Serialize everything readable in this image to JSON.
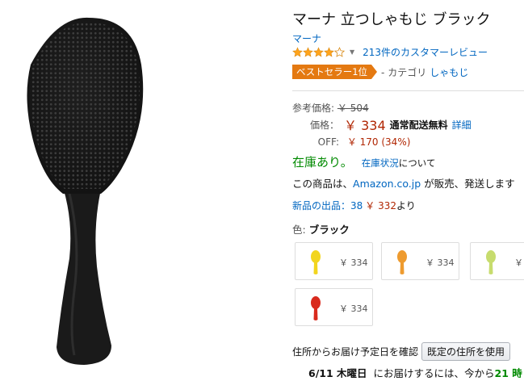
{
  "product": {
    "title": "マーナ 立つしゃもじ ブラック",
    "brand": "マーナ",
    "rating_value": 4,
    "review_link": "213件のカスタマーレビュー",
    "bestseller_badge": "ベストセラー1位",
    "category_sep": "- カテゴリ",
    "category_link": "しゃもじ"
  },
  "pricing": {
    "ref_label": "参考価格:",
    "ref_price": "￥ 504",
    "price_label": "価格：",
    "price": "￥ 334",
    "shipping": "通常配送無料",
    "details_link": "詳細",
    "off_label": "OFF:",
    "off_value": "￥ 170 (34%)"
  },
  "availability": {
    "in_stock": "在庫あり。",
    "stock_status_link": "在庫状況",
    "stock_status_suffix": "について",
    "sold_by_prefix": "この商品は、",
    "sold_by_link": "Amazon.co.jp",
    "sold_by_suffix": " が販売、発送します"
  },
  "offers": {
    "link": "新品の出品：38",
    "price": "￥ 332",
    "suffix": "より"
  },
  "color": {
    "label": "色:",
    "selected": "ブラック",
    "swatches": [
      {
        "name": "yellow",
        "price": "￥ 334",
        "color": "#f2d51e"
      },
      {
        "name": "orange",
        "price": "￥ 334",
        "color": "#ee9b2f"
      },
      {
        "name": "lime",
        "price": "￥",
        "color": "#c7dc6e"
      },
      {
        "name": "red",
        "price": "￥ 334",
        "color": "#d92a1d"
      }
    ]
  },
  "delivery": {
    "question": "住所からお届け予定日を確認",
    "button": "既定の住所を使用",
    "date": "6/11 木曜日",
    "middle": "にお届けするには、今から",
    "countdown": "21 時"
  },
  "colors": {
    "link": "#0066c0",
    "price_red": "#b12704",
    "in_stock_green": "#008a00",
    "badge_orange": "#e47911",
    "star": "#ffa41c"
  }
}
